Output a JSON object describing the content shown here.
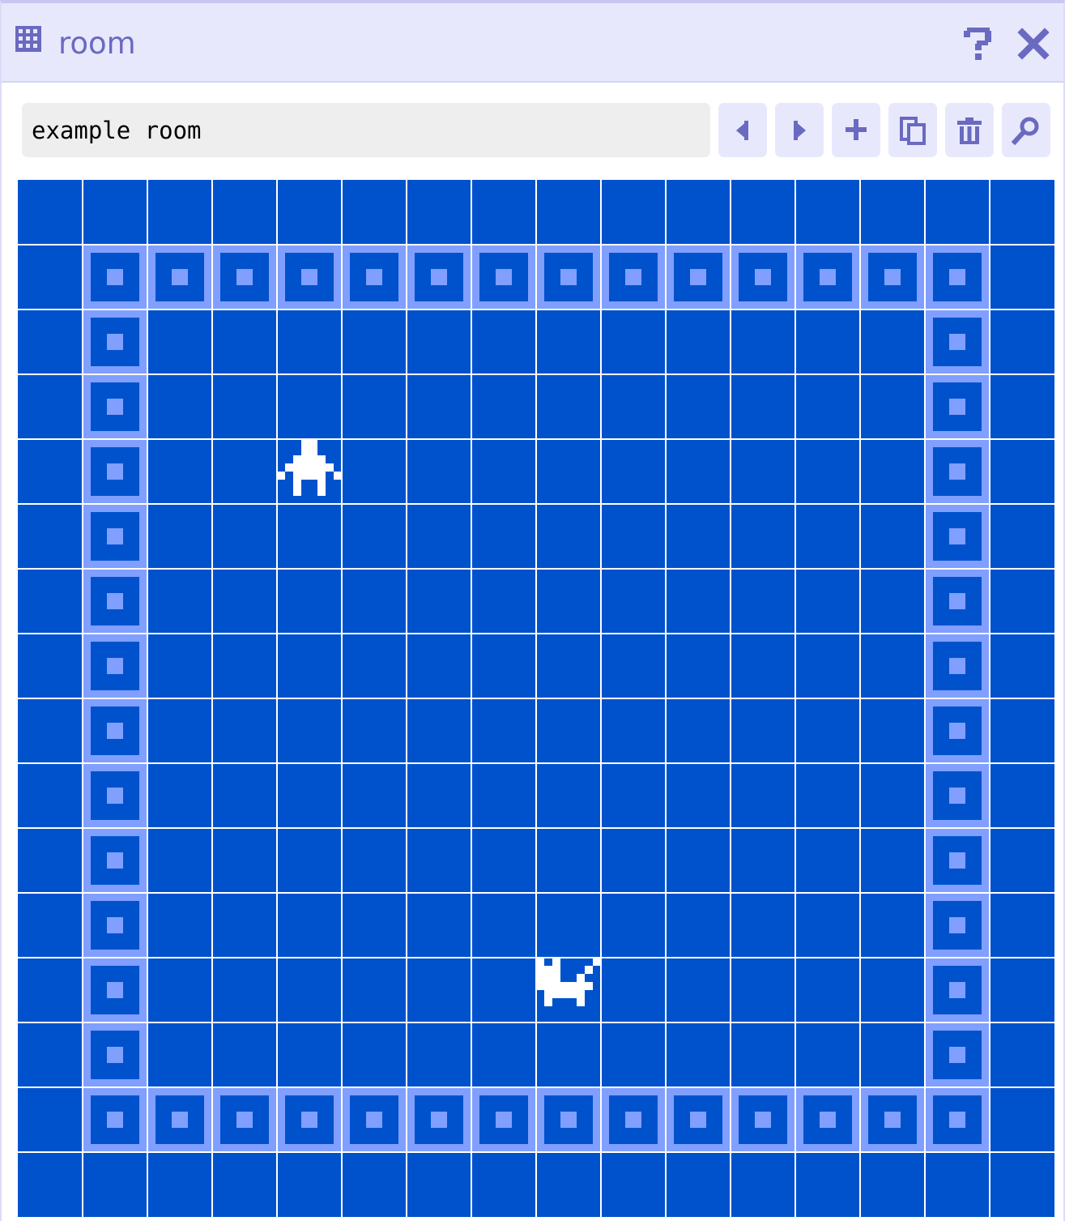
{
  "window": {
    "title": "room",
    "title_icon": "grid-icon",
    "help_icon": "question-mark-icon",
    "close_icon": "close-icon"
  },
  "toolbar": {
    "room_name": "example room",
    "buttons": [
      {
        "name": "previous-room-button",
        "icon": "triangle-left-icon"
      },
      {
        "name": "next-room-button",
        "icon": "triangle-right-icon"
      },
      {
        "name": "add-room-button",
        "icon": "plus-icon"
      },
      {
        "name": "duplicate-room-button",
        "icon": "copy-icon"
      },
      {
        "name": "delete-room-button",
        "icon": "trash-icon"
      },
      {
        "name": "find-room-button",
        "icon": "magnifier-icon"
      }
    ]
  },
  "room": {
    "grid_size": 16,
    "colors": {
      "background": "#0052cc",
      "tile": "#809fff",
      "sprite": "#ffffff",
      "grid_lines": "#ffffff",
      "chrome_accent": "#6a6ac0"
    },
    "wall_tile": "wall-block",
    "wall_rows": [
      "................",
      ".##############.",
      ".#............#.",
      ".#............#.",
      ".#............#.",
      ".#............#.",
      ".#............#.",
      ".#............#.",
      ".#............#.",
      ".#............#.",
      ".#............#.",
      ".#............#.",
      ".#............#.",
      ".#............#.",
      ".##############.",
      "................"
    ],
    "sprites": [
      {
        "name": "avatar-sprite",
        "col": 4,
        "row": 4
      },
      {
        "name": "cat-sprite",
        "col": 8,
        "row": 12
      }
    ]
  }
}
